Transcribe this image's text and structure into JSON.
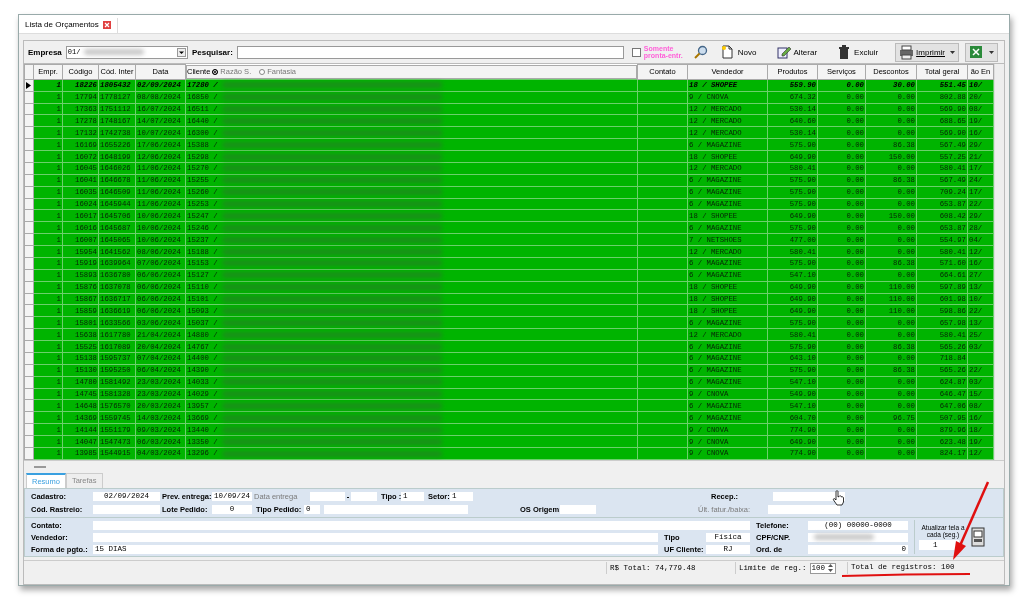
{
  "window": {
    "tab_title": "Lista de Orçamentos"
  },
  "toolbar": {
    "empresa_label": "Empresa",
    "empresa_value": "01/",
    "empresa_redacted": true,
    "search_label": "Pesquisar:",
    "ready_only": {
      "label": "Somente pronta-entr.",
      "checked": false
    },
    "buttons": [
      {
        "kind": "search"
      },
      {
        "kind": "new",
        "label": "Novo"
      },
      {
        "kind": "edit",
        "label": "Alterar"
      },
      {
        "kind": "delete",
        "label": "Excluir"
      },
      {
        "kind": "print",
        "label": "Imprimir"
      },
      {
        "kind": "excel"
      }
    ]
  },
  "table": {
    "columns": [
      "Empr.",
      "Código",
      "Cód. Inter",
      "Data",
      "Cliente",
      "Contato",
      "Vendedor",
      "Produtos",
      "Serviços",
      "Descontos",
      "Total geral",
      "ão En"
    ],
    "client_name_mode": [
      {
        "label": "Razão S.",
        "selected": true
      },
      {
        "label": "Fantasia",
        "selected": false
      }
    ],
    "rows": [
      {
        "selected": true,
        "redacted": true,
        "cells": [
          "1",
          "18226",
          "1805432",
          "02/09/2024",
          "17280 /",
          null,
          "18 / SHOPEE",
          "559.90",
          "0.00",
          "30.00",
          "551.45",
          "10/"
        ]
      },
      {
        "selected": false,
        "redacted": true,
        "cells": [
          "1",
          "17794",
          "1778127",
          "08/08/2024",
          "16850 /",
          null,
          "9 / CNOVA",
          "674.32",
          "0.00",
          "0.00",
          "802.88",
          "20/"
        ]
      },
      {
        "selected": false,
        "redacted": true,
        "cells": [
          "1",
          "17363",
          "1751112",
          "16/07/2024",
          "16511 /",
          null,
          "12 / MERCADO",
          "530.14",
          "0.00",
          "0.00",
          "569.90",
          "08/"
        ]
      },
      {
        "selected": false,
        "redacted": true,
        "cells": [
          "1",
          "17278",
          "1748167",
          "14/07/2024",
          "16440 /",
          null,
          "12 / MERCADO",
          "640.60",
          "0.00",
          "0.00",
          "688.65",
          "19/"
        ]
      },
      {
        "selected": false,
        "redacted": true,
        "cells": [
          "1",
          "17132",
          "1742738",
          "10/07/2024",
          "16300 /",
          null,
          "12 / MERCADO",
          "530.14",
          "0.00",
          "0.00",
          "569.90",
          "16/"
        ]
      },
      {
        "selected": false,
        "redacted": true,
        "cells": [
          "1",
          "16169",
          "1655226",
          "17/06/2024",
          "15388 /",
          null,
          "6 / MAGAZINE",
          "575.90",
          "0.00",
          "86.38",
          "567.49",
          "29/"
        ]
      },
      {
        "selected": false,
        "redacted": true,
        "cells": [
          "1",
          "16072",
          "1648199",
          "12/06/2024",
          "15298 /",
          null,
          "18 / SHOPEE",
          "649.90",
          "0.00",
          "150.00",
          "557.25",
          "21/"
        ]
      },
      {
        "selected": false,
        "redacted": true,
        "cells": [
          "1",
          "16045",
          "1646026",
          "11/06/2024",
          "15270 /",
          null,
          "12 / MERCADO",
          "580.41",
          "0.00",
          "0.00",
          "580.41",
          "17/"
        ]
      },
      {
        "selected": false,
        "redacted": true,
        "cells": [
          "1",
          "16041",
          "1646678",
          "11/06/2024",
          "15255 /",
          null,
          "6 / MAGAZINE",
          "575.90",
          "0.00",
          "86.38",
          "567.49",
          "24/"
        ]
      },
      {
        "selected": false,
        "redacted": true,
        "cells": [
          "1",
          "16035",
          "1646509",
          "11/06/2024",
          "15260 /",
          null,
          "6 / MAGAZINE",
          "575.90",
          "0.00",
          "0.00",
          "709.24",
          "17/"
        ]
      },
      {
        "selected": false,
        "redacted": true,
        "cells": [
          "1",
          "16024",
          "1645944",
          "11/06/2024",
          "15253 /",
          null,
          "6 / MAGAZINE",
          "575.90",
          "0.00",
          "0.00",
          "653.87",
          "22/"
        ]
      },
      {
        "selected": false,
        "redacted": true,
        "cells": [
          "1",
          "16017",
          "1645706",
          "10/06/2024",
          "15247 /",
          null,
          "18 / SHOPEE",
          "649.90",
          "0.00",
          "150.00",
          "608.42",
          "29/"
        ]
      },
      {
        "selected": false,
        "redacted": true,
        "cells": [
          "1",
          "16016",
          "1645687",
          "10/06/2024",
          "15246 /",
          null,
          "6 / MAGAZINE",
          "575.90",
          "0.00",
          "0.00",
          "653.87",
          "28/"
        ]
      },
      {
        "selected": false,
        "redacted": true,
        "cells": [
          "1",
          "16007",
          "1645065",
          "10/06/2024",
          "15237 /",
          null,
          "7 / NETSHOES",
          "477.00",
          "0.00",
          "0.00",
          "554.97",
          "04/"
        ]
      },
      {
        "selected": false,
        "redacted": true,
        "cells": [
          "1",
          "15954",
          "1641562",
          "08/06/2024",
          "15188 /",
          null,
          "12 / MERCADO",
          "580.41",
          "0.00",
          "0.00",
          "580.41",
          "12/"
        ]
      },
      {
        "selected": false,
        "redacted": true,
        "cells": [
          "1",
          "15919",
          "1639964",
          "07/06/2024",
          "15153 /",
          null,
          "6 / MAGAZINE",
          "575.90",
          "0.00",
          "86.38",
          "571.60",
          "16/"
        ]
      },
      {
        "selected": false,
        "redacted": true,
        "cells": [
          "1",
          "15893",
          "1636780",
          "06/06/2024",
          "15127 /",
          null,
          "6 / MAGAZINE",
          "547.10",
          "0.00",
          "0.00",
          "664.61",
          "27/"
        ]
      },
      {
        "selected": false,
        "redacted": true,
        "cells": [
          "1",
          "15876",
          "1637078",
          "06/06/2024",
          "15110 /",
          null,
          "18 / SHOPEE",
          "649.90",
          "0.00",
          "110.00",
          "597.89",
          "13/"
        ]
      },
      {
        "selected": false,
        "redacted": true,
        "cells": [
          "1",
          "15867",
          "1636717",
          "06/06/2024",
          "15101 /",
          null,
          "18 / SHOPEE",
          "649.90",
          "0.00",
          "110.00",
          "601.98",
          "10/"
        ]
      },
      {
        "selected": false,
        "redacted": true,
        "cells": [
          "1",
          "15859",
          "1636619",
          "06/06/2024",
          "15093 /",
          null,
          "18 / SHOPEE",
          "649.90",
          "0.00",
          "110.00",
          "598.86",
          "22/"
        ]
      },
      {
        "selected": false,
        "redacted": true,
        "cells": [
          "1",
          "15801",
          "1633566",
          "03/06/2024",
          "15037 /",
          null,
          "6 / MAGAZINE",
          "575.90",
          "0.00",
          "0.00",
          "657.98",
          "13/"
        ]
      },
      {
        "selected": false,
        "redacted": true,
        "cells": [
          "1",
          "15638",
          "1617780",
          "21/04/2024",
          "14880 /",
          null,
          "12 / MERCADO",
          "580.41",
          "0.00",
          "0.00",
          "580.41",
          "25/"
        ]
      },
      {
        "selected": false,
        "redacted": true,
        "cells": [
          "1",
          "15525",
          "1617089",
          "20/04/2024",
          "14767 /",
          null,
          "6 / MAGAZINE",
          "575.90",
          "0.00",
          "86.38",
          "565.26",
          "03/"
        ]
      },
      {
        "selected": false,
        "redacted": true,
        "cells": [
          "1",
          "15138",
          "1595737",
          "07/04/2024",
          "14400 /",
          null,
          "6 / MAGAZINE",
          "643.10",
          "0.00",
          "0.00",
          "718.84",
          null
        ]
      },
      {
        "selected": false,
        "redacted": true,
        "cells": [
          "1",
          "15130",
          "1595250",
          "06/04/2024",
          "14390 /",
          null,
          "6 / MAGAZINE",
          "575.90",
          "0.00",
          "86.38",
          "565.26",
          "22/"
        ]
      },
      {
        "selected": false,
        "redacted": true,
        "cells": [
          "1",
          "14780",
          "1581492",
          "23/03/2024",
          "14033 /",
          null,
          "6 / MAGAZINE",
          "547.10",
          "0.00",
          "0.00",
          "624.87",
          "03/"
        ]
      },
      {
        "selected": false,
        "redacted": true,
        "cells": [
          "1",
          "14745",
          "1581328",
          "23/03/2024",
          "14029 /",
          null,
          "9 / CNOVA",
          "549.90",
          "0.00",
          "0.00",
          "646.47",
          "15/"
        ]
      },
      {
        "selected": false,
        "redacted": true,
        "cells": [
          "1",
          "14648",
          "1576570",
          "20/03/2024",
          "13957 /",
          null,
          "6 / MAGAZINE",
          "547.10",
          "0.00",
          "0.00",
          "647.06",
          "08/"
        ]
      },
      {
        "selected": false,
        "redacted": true,
        "cells": [
          "1",
          "14369",
          "1559745",
          "14/03/2024",
          "13669 /",
          null,
          "6 / MAGAZINE",
          "604.70",
          "0.00",
          "96.75",
          "507.95",
          "16/"
        ]
      },
      {
        "selected": false,
        "redacted": true,
        "cells": [
          "1",
          "14144",
          "1551179",
          "09/03/2024",
          "13440 /",
          null,
          "9 / CNOVA",
          "774.90",
          "0.00",
          "0.00",
          "879.96",
          "18/"
        ]
      },
      {
        "selected": false,
        "redacted": true,
        "cells": [
          "1",
          "14047",
          "1547473",
          "06/03/2024",
          "13350 /",
          null,
          "9 / CNOVA",
          "649.90",
          "0.00",
          "0.00",
          "623.48",
          "19/"
        ]
      },
      {
        "selected": false,
        "redacted": true,
        "cells": [
          "1",
          "13985",
          "1544915",
          "04/03/2024",
          "13296 /",
          null,
          "9 / CNOVA",
          "774.90",
          "0.00",
          "0.00",
          "824.17",
          "12/"
        ]
      }
    ]
  },
  "detail_tabs": [
    {
      "label": "Resumo",
      "selected": true
    },
    {
      "label": "Tarefas",
      "selected": false
    }
  ],
  "summary": {
    "row_a": [
      {
        "kind": "label",
        "text": "Cadastro:"
      },
      {
        "kind": "field",
        "value": "02/09/2024"
      },
      {
        "kind": "label",
        "text": "Prev. entrega:"
      },
      {
        "kind": "field",
        "value": "10/09/24"
      },
      {
        "kind": "label",
        "text": "Data entrega",
        "disabled": true
      },
      {
        "kind": "field"
      },
      {
        "kind": "label",
        "text": "-"
      },
      {
        "kind": "field"
      },
      {
        "kind": "label",
        "text": "Tipo :"
      },
      {
        "kind": "field",
        "value": "1"
      },
      {
        "kind": "label",
        "text": "Setor:"
      },
      {
        "kind": "field",
        "value": "1"
      },
      {
        "kind": "label",
        "text": "Recep.:"
      },
      {
        "kind": "field"
      }
    ],
    "row_b": [
      {
        "kind": "label",
        "text": "Cód. Rastreio:"
      },
      {
        "kind": "field"
      },
      {
        "kind": "label",
        "text": "Lote Pedido:"
      },
      {
        "kind": "field",
        "value": "0"
      },
      {
        "kind": "label",
        "text": "Tipo Pedido:"
      },
      {
        "kind": "field",
        "value": "0"
      },
      {
        "kind": "field"
      },
      {
        "kind": "label",
        "text": "OS Origem:"
      },
      {
        "kind": "field"
      },
      {
        "kind": "label",
        "text": "Últ. fatur./baixa:",
        "disabled": true
      },
      {
        "kind": "field"
      }
    ],
    "contato": {
      "label": "Contato:"
    },
    "vendedor": {
      "label": "Vendedor:"
    },
    "forma_pgto": {
      "label": "Forma de pgto.:",
      "value": "15 DIAS"
    },
    "tipo": {
      "label": "Tipo",
      "value": "Física"
    },
    "uf_cliente": {
      "label": "UF Cliente:",
      "value": "RJ"
    },
    "telefone": {
      "label": "Telefone:",
      "value": "(00) 00000-0000"
    },
    "cpf_cnpj": {
      "label": "CPF/CNP.",
      "redacted": true
    },
    "ord_de": {
      "label": "Ord. de",
      "value": "0"
    },
    "refresh": {
      "label": "Atualizar tela a cada (seg.)",
      "value": "1"
    }
  },
  "status_bar": {
    "total": "R$ Total: 74,779.48",
    "limit_label": "Limite de reg.:",
    "limit_value": "100",
    "records": "Total de registros: 100"
  }
}
